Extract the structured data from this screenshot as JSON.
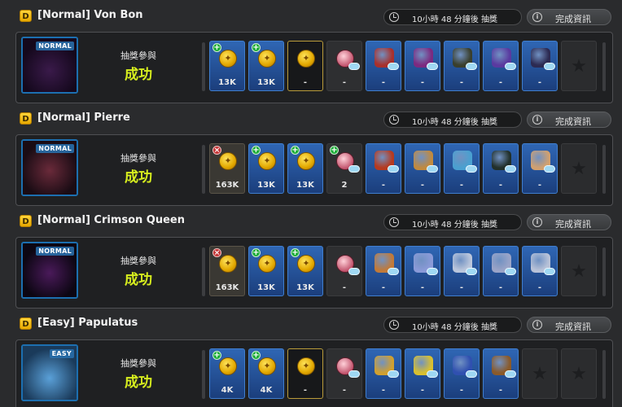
{
  "common": {
    "timer_text": "10小時 48 分鐘後 抽獎",
    "info_button_label": "完成資訊",
    "result_label": "抽獎參與",
    "result_value": "成功",
    "badge_letter": "D"
  },
  "bosses": [
    {
      "title": "[Normal] Von Bon",
      "difficulty": "NORMAL",
      "slots": [
        {
          "kind": "coin",
          "bg": "blue",
          "badge": "plus",
          "amount": "13K"
        },
        {
          "kind": "coin",
          "bg": "blue",
          "badge": "plus",
          "amount": "13K"
        },
        {
          "kind": "coin",
          "bg": "gold",
          "badge": "",
          "amount": "-"
        },
        {
          "kind": "orb",
          "bg": "gray",
          "badge": "",
          "amount": "-"
        },
        {
          "kind": "item",
          "bg": "blue",
          "color": "#a8302c",
          "amount": "-"
        },
        {
          "kind": "item",
          "bg": "blue",
          "color": "#7c2a80",
          "amount": "-"
        },
        {
          "kind": "item",
          "bg": "blue",
          "color": "#3a3f2c",
          "amount": "-"
        },
        {
          "kind": "item",
          "bg": "blue",
          "color": "#5a3aa0",
          "amount": "-"
        },
        {
          "kind": "item",
          "bg": "blue",
          "color": "#2c2a52",
          "amount": "-"
        },
        {
          "kind": "star",
          "bg": "empty",
          "amount": ""
        }
      ]
    },
    {
      "title": "[Normal] Pierre",
      "difficulty": "NORMAL",
      "slots": [
        {
          "kind": "coin",
          "bg": "brown",
          "badge": "x",
          "amount": "163K"
        },
        {
          "kind": "coin",
          "bg": "blue",
          "badge": "plus",
          "amount": "13K"
        },
        {
          "kind": "coin",
          "bg": "blue",
          "badge": "plus",
          "amount": "13K"
        },
        {
          "kind": "orb",
          "bg": "gray",
          "badge": "plus",
          "amount": "2"
        },
        {
          "kind": "item",
          "bg": "blue",
          "color": "#b53a20",
          "amount": "-"
        },
        {
          "kind": "item",
          "bg": "blue",
          "color": "#c08a40",
          "amount": "-"
        },
        {
          "kind": "item",
          "bg": "blue",
          "color": "#4aa0d0",
          "amount": "-"
        },
        {
          "kind": "item",
          "bg": "blue",
          "color": "#22302a",
          "amount": "-"
        },
        {
          "kind": "item",
          "bg": "blue",
          "color": "#d0a070",
          "amount": "-"
        },
        {
          "kind": "star",
          "bg": "empty",
          "amount": ""
        }
      ]
    },
    {
      "title": "[Normal] Crimson Queen",
      "difficulty": "NORMAL",
      "slots": [
        {
          "kind": "coin",
          "bg": "brown",
          "badge": "x",
          "amount": "163K"
        },
        {
          "kind": "coin",
          "bg": "blue",
          "badge": "plus",
          "amount": "13K"
        },
        {
          "kind": "coin",
          "bg": "blue",
          "badge": "plus",
          "amount": "13K"
        },
        {
          "kind": "orb",
          "bg": "gray",
          "badge": "",
          "amount": "-"
        },
        {
          "kind": "item",
          "bg": "blue",
          "color": "#c07a3a",
          "amount": "-"
        },
        {
          "kind": "item",
          "bg": "blue",
          "color": "#8a9ad8",
          "amount": "-"
        },
        {
          "kind": "item",
          "bg": "blue",
          "color": "#bac6dc",
          "amount": "-"
        },
        {
          "kind": "item",
          "bg": "blue",
          "color": "#9aa4c8",
          "amount": "-"
        },
        {
          "kind": "item",
          "bg": "blue",
          "color": "#b8c2d8",
          "amount": "-"
        },
        {
          "kind": "star",
          "bg": "empty",
          "amount": ""
        }
      ]
    },
    {
      "title": "[Easy] Papulatus",
      "difficulty": "EASY",
      "slots": [
        {
          "kind": "coin",
          "bg": "blue",
          "badge": "plus",
          "amount": "4K"
        },
        {
          "kind": "coin",
          "bg": "blue",
          "badge": "plus",
          "amount": "4K"
        },
        {
          "kind": "coin",
          "bg": "gold",
          "badge": "",
          "amount": "-"
        },
        {
          "kind": "orb",
          "bg": "gray",
          "badge": "",
          "amount": "-"
        },
        {
          "kind": "item",
          "bg": "blue",
          "color": "#d0a030",
          "amount": "-"
        },
        {
          "kind": "item",
          "bg": "blue",
          "color": "#d8c030",
          "amount": "-"
        },
        {
          "kind": "item",
          "bg": "blue",
          "color": "#3050b0",
          "amount": "-"
        },
        {
          "kind": "item",
          "bg": "blue",
          "color": "#8a5a2a",
          "amount": "-"
        },
        {
          "kind": "star",
          "bg": "empty",
          "amount": ""
        },
        {
          "kind": "star",
          "bg": "empty",
          "amount": ""
        }
      ]
    }
  ]
}
